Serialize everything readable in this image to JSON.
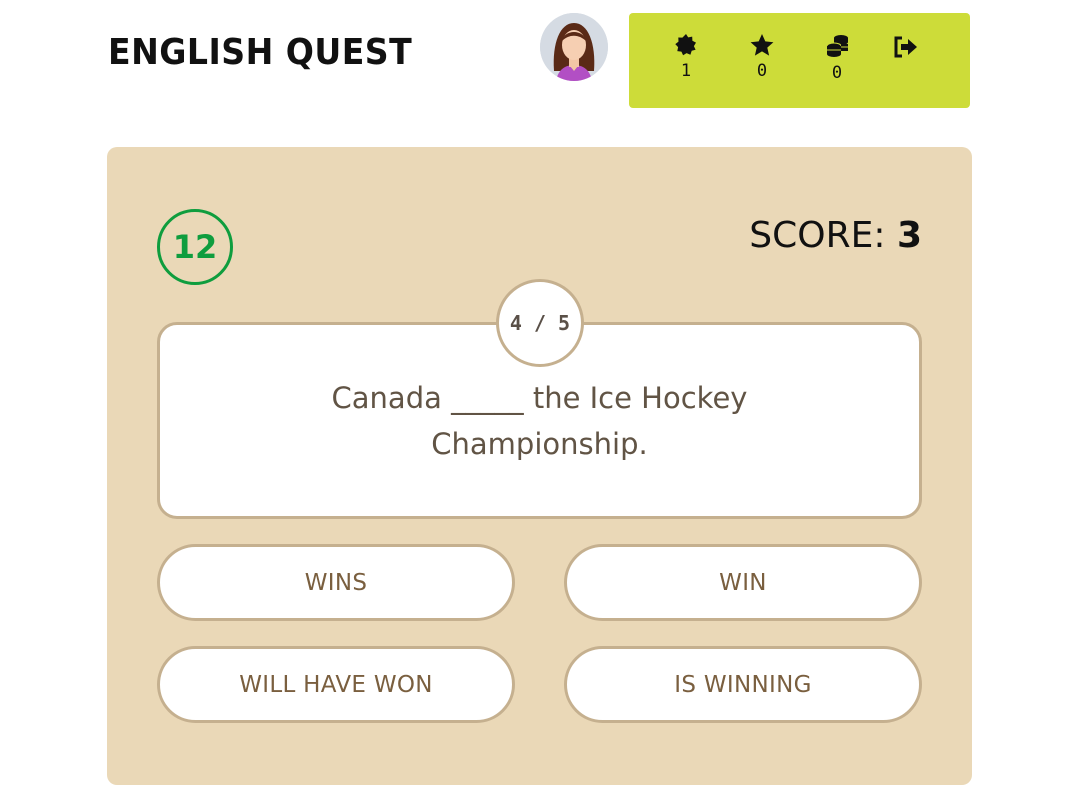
{
  "header": {
    "title": "ENGLISH QUEST"
  },
  "stats": {
    "badges": {
      "icon": "badge-icon",
      "value": "1"
    },
    "stars": {
      "icon": "star-icon",
      "value": "0"
    },
    "coins": {
      "icon": "coins-icon",
      "value": "0"
    },
    "logout_icon": "logout-icon",
    "panel_color": "#cddc39"
  },
  "quiz": {
    "timer": "12",
    "score_label": "SCORE:",
    "score_value": "3",
    "progress": "4 / 5",
    "question_line1": "Canada _____ the Ice Hockey",
    "question_line2": "Championship.",
    "answers": [
      "WINS",
      "WIN",
      "WILL HAVE WON",
      "IS WINNING"
    ],
    "card_color": "#ead8b7",
    "timer_color": "#0f9d3e"
  }
}
